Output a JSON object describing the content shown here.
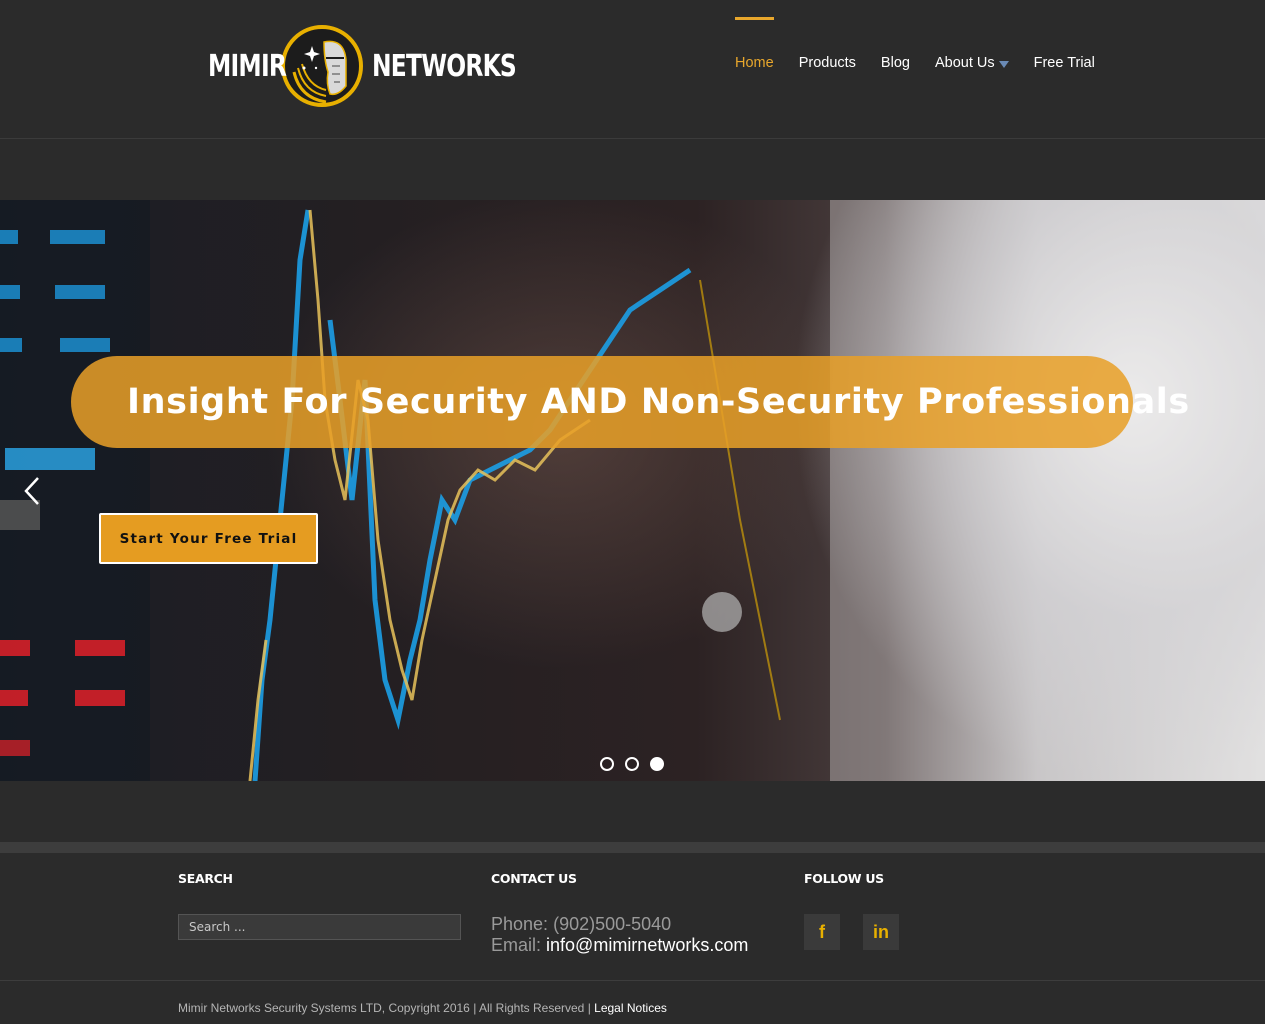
{
  "logo": {
    "word_left": "MIMIR",
    "word_right": "NETWORKS"
  },
  "nav": {
    "items": [
      {
        "label": "Home"
      },
      {
        "label": "Products"
      },
      {
        "label": "Blog"
      },
      {
        "label": "About Us"
      },
      {
        "label": "Free Trial"
      }
    ],
    "active_color": "#e8a72c"
  },
  "hero": {
    "headline": "Insight For Security AND Non-Security Professionals",
    "cta_label": "Start Your Free Trial",
    "slide_count": 3,
    "active_slide": 3,
    "accent_color": "#e59c21"
  },
  "footer": {
    "search": {
      "title": "SEARCH",
      "placeholder": "Search ..."
    },
    "contact": {
      "title": "CONTACT US",
      "phone_label": "Phone:",
      "phone": "(902)500-5040",
      "email_label": "Email:",
      "email": "info@mimirnetworks.com"
    },
    "follow": {
      "title": "FOLLOW US",
      "facebook_glyph": "f",
      "linkedin_glyph": "in",
      "icon_color": "#e8b000"
    },
    "copyright": "Mimir Networks Security Systems LTD, Copyright 2016 | All Rights Reserved |",
    "legal_link": "Legal Notices"
  }
}
